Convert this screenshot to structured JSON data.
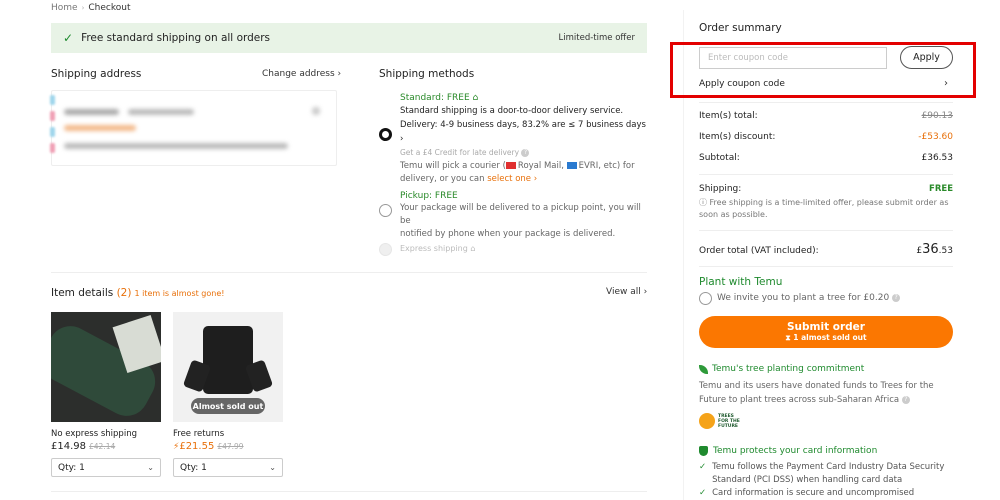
{
  "breadcrumb": {
    "home": "Home",
    "separator": "›",
    "current": "Checkout"
  },
  "banner": {
    "text": "Free standard shipping on all orders",
    "badge": "Limited-time offer",
    "icon": "check-icon"
  },
  "shipping_address": {
    "title": "Shipping address",
    "change_label": "Change address ›"
  },
  "shipping_methods": {
    "title": "Shipping methods",
    "options": [
      {
        "title": "Standard: FREE",
        "selected": true,
        "line1": "Standard shipping is a door-to-door delivery service.",
        "line2": "Delivery: 4-9 business days, 83.2% are ≤ 7 business days ›",
        "credit": "Get a £4 Credit for late delivery",
        "courier_a": "Temu will pick a courier (",
        "courier_royal": "Royal Mail,",
        "courier_evri": "EVRI, etc) for",
        "courier_b": "delivery, or you can ",
        "select_one": "select one ›"
      },
      {
        "title": "Pickup: FREE",
        "selected": false,
        "line1": "Your package will be delivered to a pickup point, you will be",
        "line2": "notified by phone when your package is delivered."
      },
      {
        "title": "Express shipping",
        "selected": false,
        "disabled": true
      }
    ]
  },
  "items": {
    "title": "Item details",
    "count": "(2)",
    "warning": "1 item is almost gone!",
    "view_all": "View all ›",
    "products": [
      {
        "label": "No express shipping",
        "price": "£14.98",
        "old_price": "£42.14",
        "qty": "Qty: 1",
        "badge": ""
      },
      {
        "label": "Free returns",
        "price": "£21.55",
        "old_price": "£47.99",
        "qty": "Qty: 1",
        "badge": "Almost sold out"
      }
    ]
  },
  "summary": {
    "title": "Order summary",
    "coupon_placeholder": "Enter coupon code",
    "apply_label": "Apply",
    "apply_coupon_link": "Apply coupon code",
    "items_total_label": "Item(s) total:",
    "items_total": "£90.13",
    "discount_label": "Item(s) discount:",
    "discount": "-£53.60",
    "subtotal_label": "Subtotal:",
    "subtotal": "£36.53",
    "shipping_label": "Shipping:",
    "shipping_value": "FREE",
    "shipping_note": "ⓘ Free shipping is a time-limited offer, please submit order as soon as possible.",
    "order_total_label": "Order total (VAT included):",
    "order_total_currency": "£",
    "order_total_main": "36",
    "order_total_decimal": ".53"
  },
  "plant": {
    "title": "Plant with Temu",
    "invite": "We invite you to plant a tree for £0.20"
  },
  "submit": {
    "label": "Submit order",
    "sub": "1 almost sold out"
  },
  "tree_commitment": {
    "title": "Temu's tree planting commitment",
    "text1": "Temu and its users have donated funds to Trees for the",
    "text2": "Future to plant trees across sub-Saharan Africa",
    "logo_text": "TREES FOR THE FUTURE"
  },
  "card_protection": {
    "title": "Temu protects your card information",
    "points": [
      {
        "l1": "Temu follows the Payment Card Industry Data Security",
        "l2": "Standard (PCI DSS) when handling card data"
      },
      {
        "l1": "Card information is secure and uncompromised",
        "l2": ""
      }
    ]
  },
  "colors": {
    "accent": "#fb7701",
    "green": "#1f8a2e",
    "highlight": "#e30000",
    "banner_bg": "#e8f3e6"
  }
}
